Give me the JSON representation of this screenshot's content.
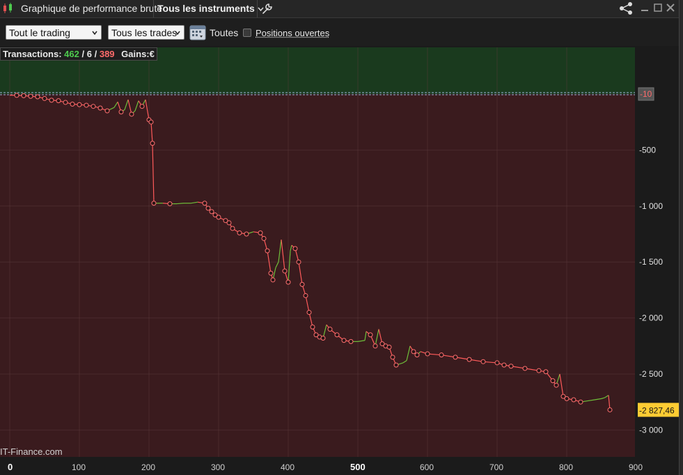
{
  "window": {
    "title": "Graphique de performance brute",
    "instruments_label": "Tous les instruments"
  },
  "toolbar": {
    "scope_select": "Tout le trading",
    "trades_select": "Tous les trades",
    "period_label": "Toutes",
    "open_positions_label": "Positions ouvertes",
    "open_positions_checked": false
  },
  "stats": {
    "transactions_label": "Transactions:",
    "winning": "462",
    "sep1": "/",
    "neutral": "6",
    "sep2": "/",
    "losing": "389",
    "gains_label": "Gains:",
    "gains_unit": "€"
  },
  "watermark": "IT-Finance.com",
  "colors": {
    "positive_zone": "#1a3a1e",
    "negative_zone": "#3a1b1e",
    "up_line": "#6fbf3a",
    "down_line": "#ff5a5a",
    "current_badge": "#ffcc33"
  },
  "chart_data": {
    "type": "line",
    "title": "",
    "xlabel": "",
    "ylabel": "",
    "xlim": [
      0,
      900
    ],
    "ylim": [
      -3250,
      420
    ],
    "x_ticks": [
      "0",
      "100",
      "200",
      "300",
      "400",
      "500",
      "600",
      "700",
      "800",
      "900"
    ],
    "y_ticks": [
      "-500",
      "-1 000",
      "-1 500",
      "-2 000",
      "-2 500",
      "-3 000"
    ],
    "zero_marker_label": "-10",
    "current_value_label": "-2 827,46",
    "series": [
      {
        "points": [
          [
            0,
            -10
          ],
          [
            10,
            -12
          ],
          [
            20,
            -15
          ],
          [
            30,
            -20
          ],
          [
            40,
            -25
          ],
          [
            50,
            -40
          ],
          [
            60,
            -55
          ],
          [
            70,
            -60
          ],
          [
            80,
            -75
          ],
          [
            90,
            -90
          ],
          [
            100,
            -95
          ],
          [
            110,
            -100
          ],
          [
            120,
            -110
          ],
          [
            130,
            -125
          ],
          [
            140,
            -150
          ],
          [
            150,
            -120
          ],
          [
            155,
            -70
          ],
          [
            160,
            -160
          ],
          [
            165,
            -140
          ],
          [
            170,
            -50
          ],
          [
            175,
            -180
          ],
          [
            180,
            -150
          ],
          [
            185,
            -60
          ],
          [
            190,
            -110
          ],
          [
            195,
            -50
          ],
          [
            200,
            -230
          ],
          [
            203,
            -250
          ],
          [
            205,
            -440
          ],
          [
            207,
            -975
          ],
          [
            210,
            -975
          ],
          [
            220,
            -975
          ],
          [
            230,
            -980
          ],
          [
            240,
            -980
          ],
          [
            250,
            -975
          ],
          [
            260,
            -975
          ],
          [
            270,
            -965
          ],
          [
            280,
            -975
          ],
          [
            285,
            -1020
          ],
          [
            290,
            -1050
          ],
          [
            295,
            -1080
          ],
          [
            300,
            -1100
          ],
          [
            310,
            -1130
          ],
          [
            315,
            -1150
          ],
          [
            320,
            -1200
          ],
          [
            330,
            -1240
          ],
          [
            340,
            -1250
          ],
          [
            350,
            -1230
          ],
          [
            360,
            -1240
          ],
          [
            365,
            -1290
          ],
          [
            370,
            -1400
          ],
          [
            375,
            -1600
          ],
          [
            378,
            -1660
          ],
          [
            382,
            -1550
          ],
          [
            386,
            -1500
          ],
          [
            390,
            -1300
          ],
          [
            395,
            -1580
          ],
          [
            400,
            -1680
          ],
          [
            403,
            -1400
          ],
          [
            405,
            -1350
          ],
          [
            410,
            -1380
          ],
          [
            415,
            -1500
          ],
          [
            420,
            -1700
          ],
          [
            425,
            -1800
          ],
          [
            430,
            -1950
          ],
          [
            435,
            -2080
          ],
          [
            440,
            -2150
          ],
          [
            445,
            -2170
          ],
          [
            450,
            -2180
          ],
          [
            455,
            -2060
          ],
          [
            460,
            -2100
          ],
          [
            470,
            -2150
          ],
          [
            480,
            -2200
          ],
          [
            490,
            -2210
          ],
          [
            500,
            -2210
          ],
          [
            510,
            -2200
          ],
          [
            512,
            -2120
          ],
          [
            518,
            -2150
          ],
          [
            525,
            -2250
          ],
          [
            530,
            -2100
          ],
          [
            535,
            -2230
          ],
          [
            540,
            -2250
          ],
          [
            545,
            -2260
          ],
          [
            550,
            -2350
          ],
          [
            555,
            -2420
          ],
          [
            560,
            -2410
          ],
          [
            565,
            -2400
          ],
          [
            570,
            -2380
          ],
          [
            575,
            -2250
          ],
          [
            580,
            -2300
          ],
          [
            585,
            -2330
          ],
          [
            590,
            -2300
          ],
          [
            600,
            -2320
          ],
          [
            620,
            -2330
          ],
          [
            640,
            -2350
          ],
          [
            660,
            -2370
          ],
          [
            680,
            -2390
          ],
          [
            700,
            -2400
          ],
          [
            710,
            -2420
          ],
          [
            720,
            -2430
          ],
          [
            740,
            -2450
          ],
          [
            760,
            -2470
          ],
          [
            770,
            -2480
          ],
          [
            780,
            -2560
          ],
          [
            785,
            -2600
          ],
          [
            790,
            -2500
          ],
          [
            795,
            -2700
          ],
          [
            800,
            -2720
          ],
          [
            810,
            -2730
          ],
          [
            820,
            -2750
          ],
          [
            830,
            -2740
          ],
          [
            840,
            -2730
          ],
          [
            850,
            -2720
          ],
          [
            855,
            -2710
          ],
          [
            860,
            -2690
          ],
          [
            862,
            -2820
          ]
        ]
      }
    ]
  }
}
